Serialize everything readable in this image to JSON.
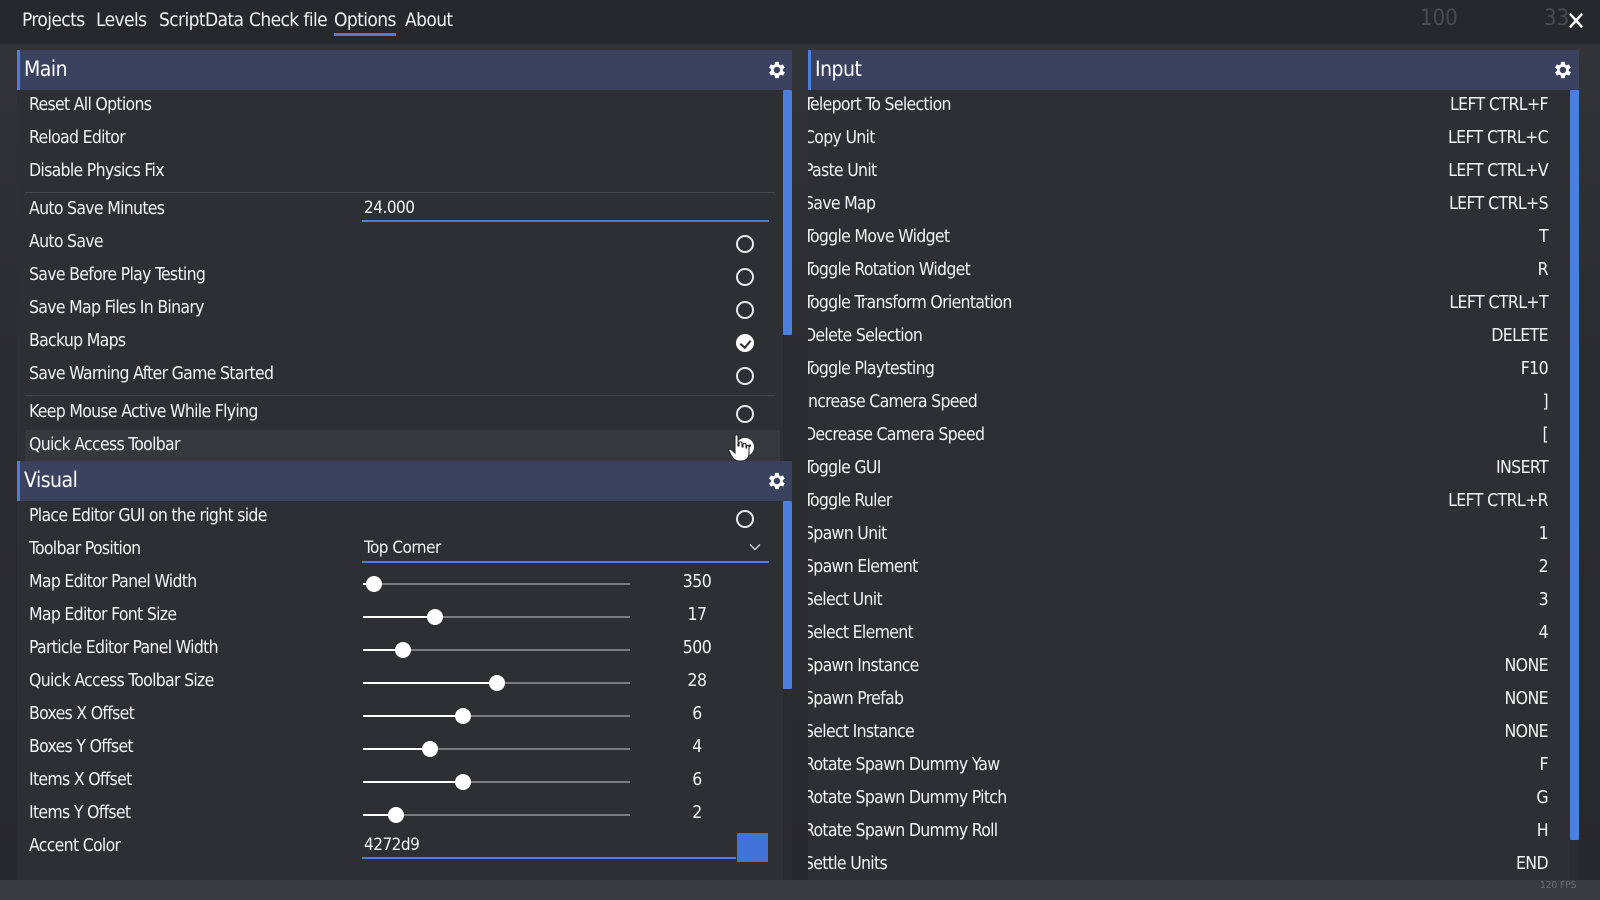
{
  "menu": {
    "items": [
      {
        "label": "Projects",
        "active": false
      },
      {
        "label": "Levels",
        "active": false
      },
      {
        "label": "ScriptData",
        "active": false
      },
      {
        "label": "Check file",
        "active": false
      },
      {
        "label": "Options",
        "active": true
      },
      {
        "label": "About",
        "active": false
      }
    ],
    "bg_stat_1": "100",
    "bg_stat_2": "33",
    "close_label": "✕"
  },
  "colors": {
    "accent": "#4a7fe0",
    "panel_bg": "#2e2f33",
    "header_bg": "#3a4260",
    "swatch": "#4272d9"
  },
  "main": {
    "title": "Main",
    "actions": [
      "Reset All Options",
      "Reload Editor",
      "Disable Physics Fix"
    ],
    "auto_save": {
      "label": "Auto Save Minutes",
      "value": "24.000"
    },
    "toggles": [
      {
        "label": "Auto Save",
        "checked": false
      },
      {
        "label": "Save Before Play Testing",
        "checked": false
      },
      {
        "label": "Save Map Files In Binary",
        "checked": false
      },
      {
        "label": "Backup Maps",
        "checked": true
      },
      {
        "label": "Save Warning After Game Started",
        "checked": false
      }
    ],
    "toggles2": [
      {
        "label": "Keep Mouse Active While Flying",
        "checked": false
      },
      {
        "label": "Quick Access Toolbar",
        "checked": true
      }
    ]
  },
  "visual": {
    "title": "Visual",
    "gui_right": {
      "label": "Place Editor GUI on the right side",
      "checked": false
    },
    "toolbar_position": {
      "label": "Toolbar Position",
      "value": "Top Corner"
    },
    "sliders": [
      {
        "label": "Map Editor Panel Width",
        "value": "350",
        "fraction": 0.04
      },
      {
        "label": "Map Editor Font Size",
        "value": "17",
        "fraction": 0.27
      },
      {
        "label": "Particle Editor Panel Width",
        "value": "500",
        "fraction": 0.15
      },
      {
        "label": "Quick Access Toolbar Size",
        "value": "28",
        "fraction": 0.5
      },
      {
        "label": "Boxes X Offset",
        "value": "6",
        "fraction": 0.375
      },
      {
        "label": "Boxes Y Offset",
        "value": "4",
        "fraction": 0.25
      },
      {
        "label": "Items X Offset",
        "value": "6",
        "fraction": 0.375
      },
      {
        "label": "Items Y Offset",
        "value": "2",
        "fraction": 0.125
      }
    ],
    "accent_color": {
      "label": "Accent Color",
      "value": "4272d9"
    }
  },
  "input": {
    "title": "Input",
    "bindings": [
      {
        "action": "Teleport To Selection",
        "key": "LEFT CTRL+F"
      },
      {
        "action": "Copy Unit",
        "key": "LEFT CTRL+C"
      },
      {
        "action": "Paste Unit",
        "key": "LEFT CTRL+V"
      },
      {
        "action": "Save Map",
        "key": "LEFT CTRL+S"
      },
      {
        "action": "Toggle Move Widget",
        "key": "T"
      },
      {
        "action": "Toggle Rotation Widget",
        "key": "R"
      },
      {
        "action": "Toggle Transform Orientation",
        "key": "LEFT CTRL+T"
      },
      {
        "action": "Delete Selection",
        "key": "DELETE"
      },
      {
        "action": "Toggle Playtesting",
        "key": "F10"
      },
      {
        "action": "Increase Camera Speed",
        "key": "]"
      },
      {
        "action": "Decrease Camera Speed",
        "key": "["
      },
      {
        "action": "Toggle GUI",
        "key": "INSERT"
      },
      {
        "action": "Toggle Ruler",
        "key": "LEFT CTRL+R"
      },
      {
        "action": "Spawn Unit",
        "key": "1"
      },
      {
        "action": "Spawn Element",
        "key": "2"
      },
      {
        "action": "Select Unit",
        "key": "3"
      },
      {
        "action": "Select Element",
        "key": "4"
      },
      {
        "action": "Spawn Instance",
        "key": "NONE"
      },
      {
        "action": "Spawn Prefab",
        "key": "NONE"
      },
      {
        "action": "Select Instance",
        "key": "NONE"
      },
      {
        "action": "Rotate Spawn Dummy Yaw",
        "key": "F"
      },
      {
        "action": "Rotate Spawn Dummy Pitch",
        "key": "G"
      },
      {
        "action": "Rotate Spawn Dummy Roll",
        "key": "H"
      },
      {
        "action": "Settle Units",
        "key": "END"
      }
    ]
  },
  "status": {
    "fps": "120 FPS"
  }
}
